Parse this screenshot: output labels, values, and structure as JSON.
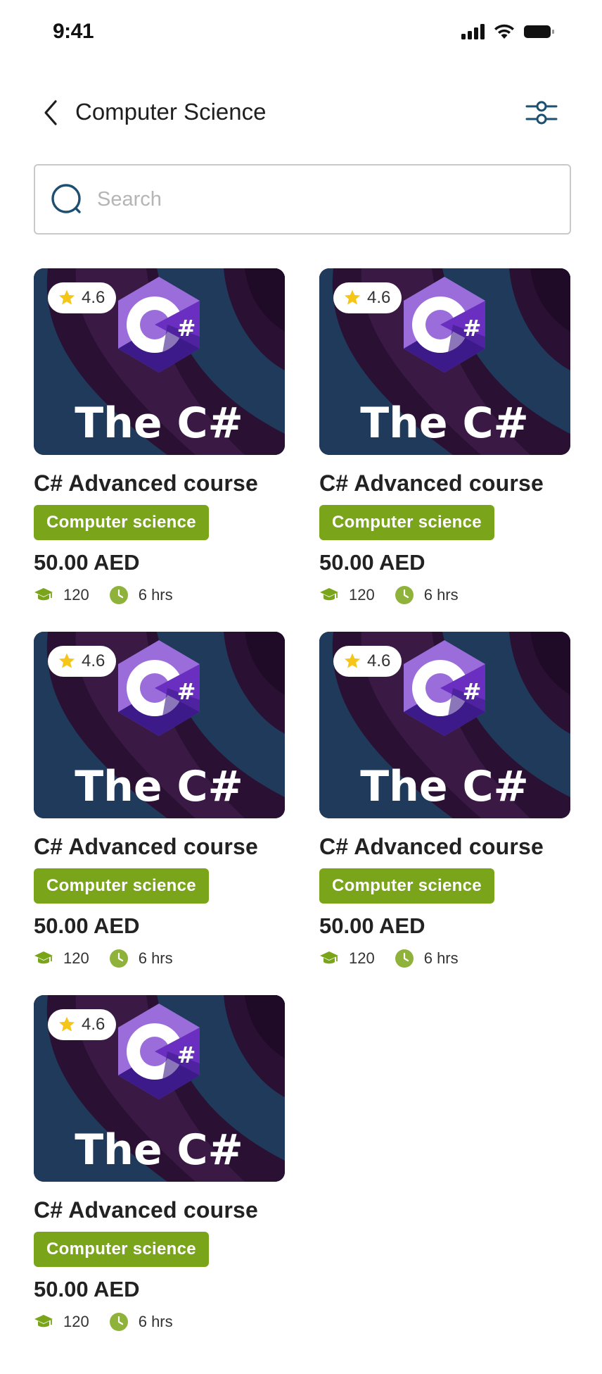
{
  "status_bar": {
    "time": "9:41"
  },
  "header": {
    "title": "Computer Science"
  },
  "search": {
    "placeholder": "Search"
  },
  "colors": {
    "accent_green": "#7aa51b",
    "icon_blue": "#1d4f72",
    "star": "#f5c518"
  },
  "courses": [
    {
      "title": "C# Advanced course",
      "category": "Computer science",
      "price": "50.00 AED",
      "rating": "4.6",
      "students": "120",
      "duration": "6 hrs",
      "cover_text": "The C#"
    },
    {
      "title": "C# Advanced course",
      "category": "Computer science",
      "price": "50.00 AED",
      "rating": "4.6",
      "students": "120",
      "duration": "6 hrs",
      "cover_text": "The C#"
    },
    {
      "title": "C# Advanced course",
      "category": "Computer science",
      "price": "50.00 AED",
      "rating": "4.6",
      "students": "120",
      "duration": "6 hrs",
      "cover_text": "The C#"
    },
    {
      "title": "C# Advanced course",
      "category": "Computer science",
      "price": "50.00 AED",
      "rating": "4.6",
      "students": "120",
      "duration": "6 hrs",
      "cover_text": "The C#"
    },
    {
      "title": "C# Advanced course",
      "category": "Computer science",
      "price": "50.00 AED",
      "rating": "4.6",
      "students": "120",
      "duration": "6 hrs",
      "cover_text": "The C#"
    }
  ],
  "icons": {
    "back": "chevron-left-icon",
    "filter": "sliders-icon",
    "search": "search-icon",
    "star": "star-icon",
    "students": "graduation-cap-icon",
    "duration": "clock-icon"
  }
}
